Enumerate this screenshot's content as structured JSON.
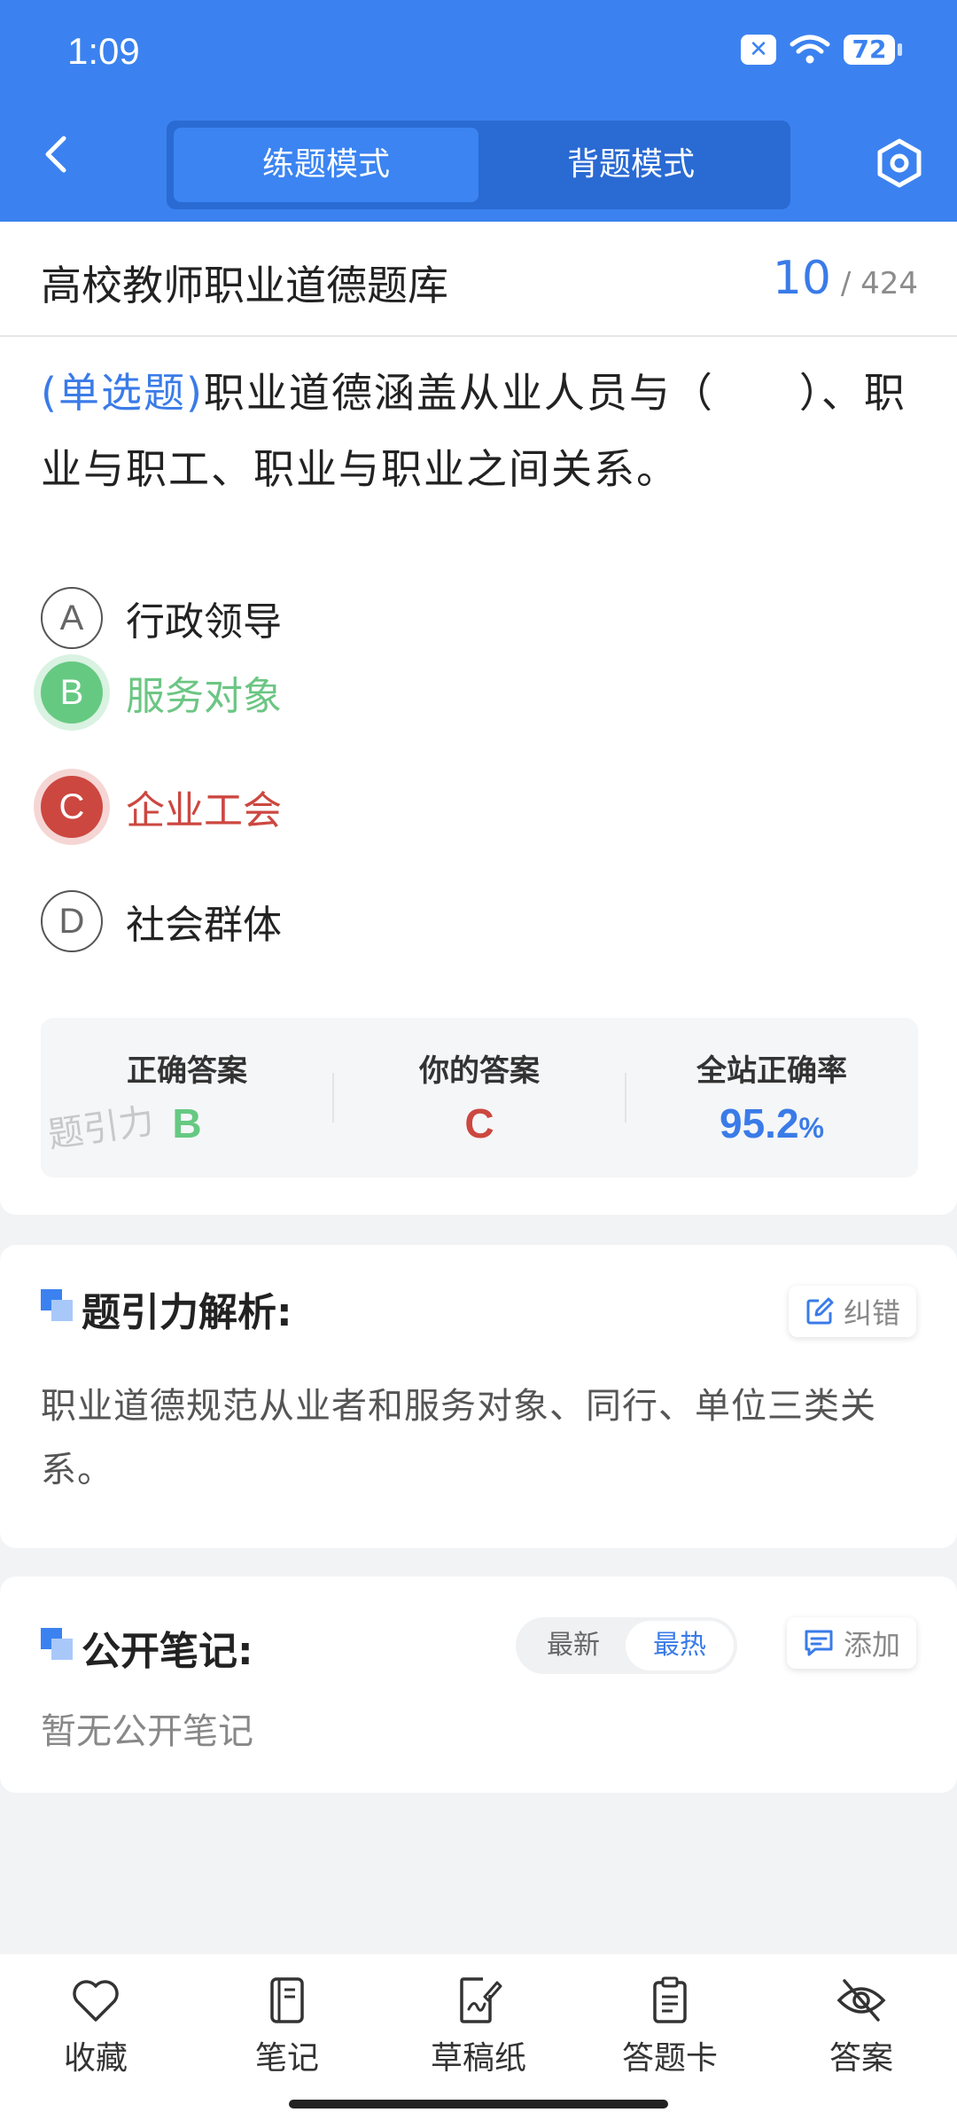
{
  "status_bar": {
    "time": "1:09",
    "battery": "72"
  },
  "header": {
    "modes": [
      "练题模式",
      "背题模式"
    ],
    "active_mode": "练题模式"
  },
  "question_bank": {
    "title": "高校教师职业道德题库",
    "current": "10",
    "total": "/ 424"
  },
  "question": {
    "type_tag": "(单选题)",
    "text": "职业道德涵盖从业人员与（　　）、职业与职工、职业与职业之间关系。"
  },
  "options": [
    {
      "letter": "A",
      "text": "行政领导",
      "state": "normal"
    },
    {
      "letter": "B",
      "text": "服务对象",
      "state": "correct"
    },
    {
      "letter": "C",
      "text": "企业工会",
      "state": "wrong"
    },
    {
      "letter": "D",
      "text": "社会群体",
      "state": "normal"
    }
  ],
  "summary": {
    "correct_label": "正确答案",
    "correct_value": "B",
    "yours_label": "你的答案",
    "yours_value": "C",
    "rate_label": "全站正确率",
    "rate_value": "95.2",
    "rate_unit": "%",
    "watermark": "题引力"
  },
  "analysis": {
    "title": "题引力解析:",
    "report_label": "纠错",
    "text": "职业道德规范从业者和服务对象、同行、单位三类关系。"
  },
  "notes": {
    "title": "公开笔记:",
    "sort_latest": "最新",
    "sort_hottest": "最热",
    "add_label": "添加",
    "empty_text": "暂无公开笔记"
  },
  "bottom_nav": [
    {
      "label": "收藏",
      "icon": "heart-icon"
    },
    {
      "label": "笔记",
      "icon": "notebook-icon"
    },
    {
      "label": "草稿纸",
      "icon": "draft-paper-icon"
    },
    {
      "label": "答题卡",
      "icon": "answer-card-icon"
    },
    {
      "label": "答案",
      "icon": "eye-off-icon"
    }
  ],
  "colors": {
    "brand": "#3b82f0",
    "correct": "#66c982",
    "wrong": "#cc4740"
  }
}
